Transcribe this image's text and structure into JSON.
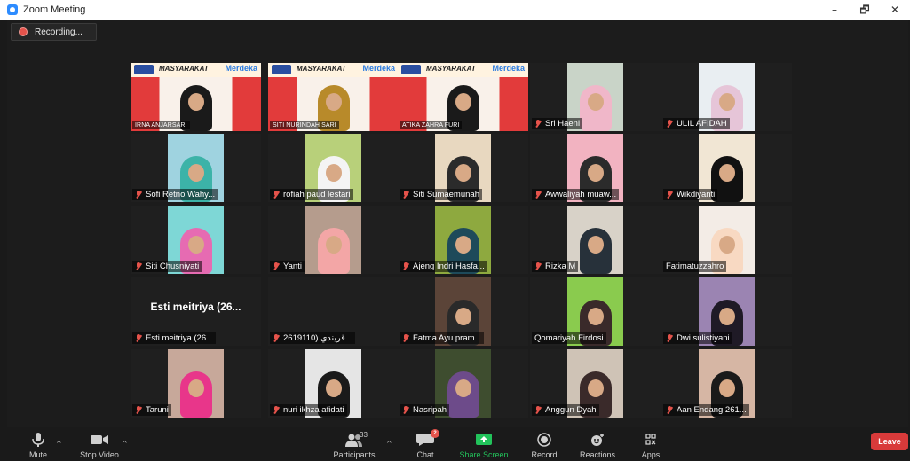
{
  "window": {
    "title": "Zoom Meeting",
    "controls": [
      "–",
      "🗗",
      "✕"
    ]
  },
  "recording": {
    "label": "Recording..."
  },
  "tiles": [
    {
      "name": "IRNA ANJARSARI",
      "style": "banner",
      "caps": true,
      "active": true,
      "hijab": "#1a1a1a",
      "bg": "#e23b3b"
    },
    {
      "name": "SITI NURINDAH SARI",
      "style": "banner",
      "caps": true,
      "hijab": "#b88a2a",
      "bg": "#e23b3b"
    },
    {
      "name": "ATIKA ZAHRA FURI",
      "style": "banner",
      "caps": true,
      "hijab": "#1a1a1a",
      "bg": "#e23b3b"
    },
    {
      "name": "Sri Haeni",
      "muted": true,
      "hijab": "#f0b7c9",
      "bg": "#c9d4c8"
    },
    {
      "name": "ULIL AFIDAH",
      "muted": true,
      "hijab": "#e6c5d8",
      "bg": "#e9eef2"
    },
    {
      "name": "Sofi Retno Wahy...",
      "muted": true,
      "hijab": "#3cb3a8",
      "bg": "#9fd3e0"
    },
    {
      "name": "rofiah paud lestari",
      "muted": true,
      "hijab": "#f4f4f4",
      "bg": "#b8d07a"
    },
    {
      "name": "Siti Sumaemunah",
      "muted": true,
      "hijab": "#2b2b2b",
      "bg": "#e8d8c0"
    },
    {
      "name": "Awwaliyah muaw...",
      "muted": true,
      "hijab": "#2b2b2b",
      "bg": "#f2b3c1"
    },
    {
      "name": "Wikdiyanti",
      "muted": true,
      "hijab": "#111111",
      "bg": "#f1e6d4"
    },
    {
      "name": "Siti Chusniyati",
      "muted": true,
      "hijab": "#e66bb2",
      "bg": "#7ed7d6"
    },
    {
      "name": "Yanti",
      "muted": true,
      "hijab": "#f3a6a6",
      "bg": "#b59c8d"
    },
    {
      "name": "Ajeng Indri Hasfa...",
      "muted": true,
      "hijab": "#1e4a5a",
      "bg": "#8ea93f"
    },
    {
      "name": "Rizka M",
      "muted": true,
      "hijab": "#27313a",
      "bg": "#d8d2c8"
    },
    {
      "name": "Fatimatuzzahro",
      "muted": false,
      "hijab": "#f8d9c2",
      "bg": "#f3ece6"
    },
    {
      "name": "Esti meitriya (26...",
      "muted": true,
      "style": "nocam",
      "big": "Esti meitriya (26..."
    },
    {
      "name": "2619110) قريندي...",
      "muted": true,
      "style": "blank"
    },
    {
      "name": "Fatma Ayu pram...",
      "muted": true,
      "hijab": "#2a2a2a",
      "bg": "#5b4438"
    },
    {
      "name": "Qomariyah Firdosi",
      "muted": false,
      "hijab": "#3a2a2a",
      "bg": "#8acb4e"
    },
    {
      "name": "Dwi sulistiyani",
      "muted": true,
      "hijab": "#1f1a26",
      "bg": "#9b84b2"
    },
    {
      "name": "Taruni",
      "muted": true,
      "hijab": "#e8368a",
      "bg": "#c7a89a"
    },
    {
      "name": "nuri ikhza afidati",
      "muted": true,
      "hijab": "#1a1a1a",
      "bg": "#e5e5e5"
    },
    {
      "name": "Nasripah",
      "muted": true,
      "hijab": "#6d4b8a",
      "bg": "#3e4d2f"
    },
    {
      "name": "Anggun Dyah",
      "muted": true,
      "hijab": "#3a2a2a",
      "bg": "#cfc3b6"
    },
    {
      "name": "Aan Endang 261...",
      "muted": true,
      "hijab": "#1a1a1a",
      "bg": "#d6b6a4"
    }
  ],
  "toolbar": {
    "mute": "Mute",
    "stop_video": "Stop Video",
    "participants": "Participants",
    "participant_count": "33",
    "chat": "Chat",
    "chat_badge": "2",
    "share_screen": "Share Screen",
    "record": "Record",
    "reactions": "Reactions",
    "apps": "Apps",
    "leave": "Leave",
    "accent_green": "#22c35b",
    "leave_red": "#d93a3a"
  },
  "banner": {
    "text": "MASYARAKAT",
    "brand": "Merdeka"
  }
}
